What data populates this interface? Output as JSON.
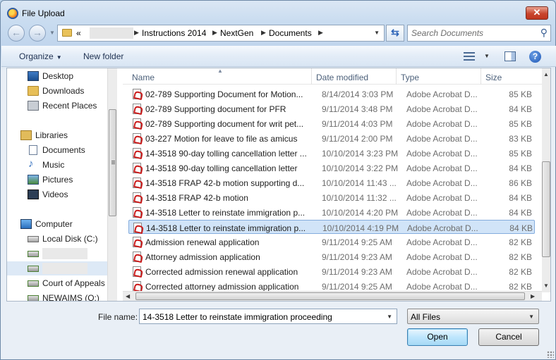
{
  "window": {
    "title": "File Upload",
    "close_label": "✕"
  },
  "address": {
    "prefix": "«",
    "crumbs": [
      "Instructions 2014",
      "NextGen",
      "Documents"
    ],
    "search_placeholder": "Search Documents"
  },
  "toolbar": {
    "organize": "Organize",
    "new_folder": "New folder",
    "help": "?"
  },
  "nav": {
    "favorites": [
      "Desktop",
      "Downloads",
      "Recent Places"
    ],
    "libraries_header": "Libraries",
    "libraries": [
      "Documents",
      "Music",
      "Pictures",
      "Videos"
    ],
    "computer_header": "Computer",
    "drives": [
      "Local Disk (C:)",
      "Court of Appeals",
      "NEWAIMS (Q:)"
    ]
  },
  "columns": {
    "name": "Name",
    "date": "Date modified",
    "type": "Type",
    "size": "Size"
  },
  "files": [
    {
      "name": "02-789 Supporting Document for Motion...",
      "date": "8/14/2014 3:03 PM",
      "type": "Adobe Acrobat D...",
      "size": "85 KB"
    },
    {
      "name": "02-789 Supporting document for PFR",
      "date": "9/11/2014 3:48 PM",
      "type": "Adobe Acrobat D...",
      "size": "84 KB"
    },
    {
      "name": "02-789 Supporting document for writ pet...",
      "date": "9/11/2014 4:03 PM",
      "type": "Adobe Acrobat D...",
      "size": "85 KB"
    },
    {
      "name": "03-227 Motion for leave to file as amicus",
      "date": "9/11/2014 2:00 PM",
      "type": "Adobe Acrobat D...",
      "size": "83 KB"
    },
    {
      "name": "14-3518 90-day tolling cancellation letter ...",
      "date": "10/10/2014 3:23 PM",
      "type": "Adobe Acrobat D...",
      "size": "85 KB"
    },
    {
      "name": "14-3518 90-day tolling cancellation letter",
      "date": "10/10/2014 3:22 PM",
      "type": "Adobe Acrobat D...",
      "size": "84 KB"
    },
    {
      "name": "14-3518 FRAP 42-b motion supporting d...",
      "date": "10/10/2014 11:43 ...",
      "type": "Adobe Acrobat D...",
      "size": "86 KB"
    },
    {
      "name": "14-3518 FRAP 42-b motion",
      "date": "10/10/2014 11:32 ...",
      "type": "Adobe Acrobat D...",
      "size": "84 KB"
    },
    {
      "name": "14-3518 Letter to reinstate immigration p...",
      "date": "10/10/2014 4:20 PM",
      "type": "Adobe Acrobat D...",
      "size": "84 KB"
    },
    {
      "name": "14-3518 Letter to reinstate immigration p...",
      "date": "10/10/2014 4:19 PM",
      "type": "Adobe Acrobat D...",
      "size": "84 KB"
    },
    {
      "name": "Admission renewal application",
      "date": "9/11/2014 9:25 AM",
      "type": "Adobe Acrobat D...",
      "size": "82 KB"
    },
    {
      "name": "Attorney admission application",
      "date": "9/11/2014 9:23 AM",
      "type": "Adobe Acrobat D...",
      "size": "82 KB"
    },
    {
      "name": "Corrected admission renewal application",
      "date": "9/11/2014 9:23 AM",
      "type": "Adobe Acrobat D...",
      "size": "82 KB"
    },
    {
      "name": "Corrected attorney admission application",
      "date": "9/11/2014 9:25 AM",
      "type": "Adobe Acrobat D...",
      "size": "82 KB"
    }
  ],
  "selected_row": 9,
  "bottom": {
    "file_name_label": "File name:",
    "file_name_value": "14-3518 Letter to reinstate immigration proceeding",
    "filter_value": "All Files",
    "open_label": "Open",
    "cancel_label": "Cancel"
  },
  "colors": {
    "selection": "#d1e4f8",
    "selection_border": "#84acdd",
    "pdf_red": "#c91b1b"
  }
}
